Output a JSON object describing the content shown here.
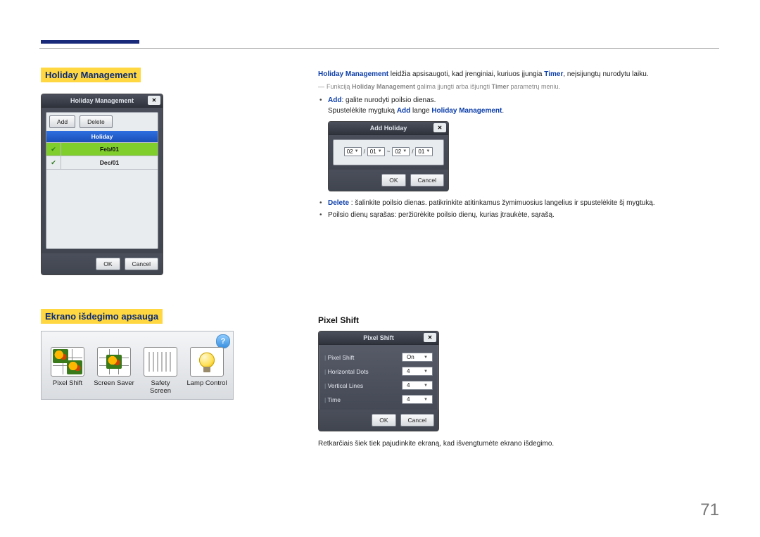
{
  "page_number": "71",
  "sections": {
    "holiday": {
      "title": "Holiday Management",
      "win": {
        "title": "Holiday Management",
        "add": "Add",
        "delete": "Delete",
        "header": "Holiday",
        "rows": [
          "Feb/01",
          "Dec/01"
        ],
        "ok": "OK",
        "cancel": "Cancel"
      },
      "intro_prefix": "Holiday Management",
      "intro_middle": " leidžia apsisaugoti, kad įrenginiai, kuriuos įjungia ",
      "intro_timer": "Timer",
      "intro_suffix": ", neįsijungtų nurodytu laiku.",
      "note_prefix": "Funkciją ",
      "note_hm": "Holiday Management",
      "note_mid": " galima įjungti arba išjungti ",
      "note_timer": "Timer",
      "note_suffix": " parametrų meniu.",
      "b1_add": "Add",
      "b1_text": ": galite nurodyti poilsio dienas.",
      "b1_sub_prefix": "Spustelėkite mygtuką ",
      "b1_sub_add": "Add",
      "b1_sub_mid": " lange ",
      "b1_sub_hm": "Holiday Management",
      "b1_sub_suffix": ".",
      "addwin": {
        "title": "Add Holiday",
        "m1": "02",
        "d1": "01",
        "m2": "02",
        "d2": "01",
        "ok": "OK",
        "cancel": "Cancel"
      },
      "b2_del": "Delete",
      "b2_text": " : šalinkite poilsio dienas. patikrinkite atitinkamus žymimuosius langelius ir spustelėkite šį mygtuką.",
      "b3_text": "Poilsio dienų sąrašas: peržiūrėkite poilsio dienų, kurias įtraukėte, sąrašą."
    },
    "burn": {
      "title": "Ekrano išdegimo apsauga",
      "items": [
        "Pixel Shift",
        "Screen Saver",
        "Safety Screen",
        "Lamp Control"
      ]
    },
    "pixel": {
      "title": "Pixel Shift",
      "win": {
        "title": "Pixel Shift",
        "rows": [
          {
            "label": "Pixel Shift",
            "value": "On"
          },
          {
            "label": "Horizontal Dots",
            "value": "4"
          },
          {
            "label": "Vertical Lines",
            "value": "4"
          },
          {
            "label": "Time",
            "value": "4"
          }
        ],
        "ok": "OK",
        "cancel": "Cancel"
      },
      "caption": "Retkarčiais šiek tiek pajudinkite ekraną, kad išvengtumėte ekrano išdegimo."
    }
  }
}
